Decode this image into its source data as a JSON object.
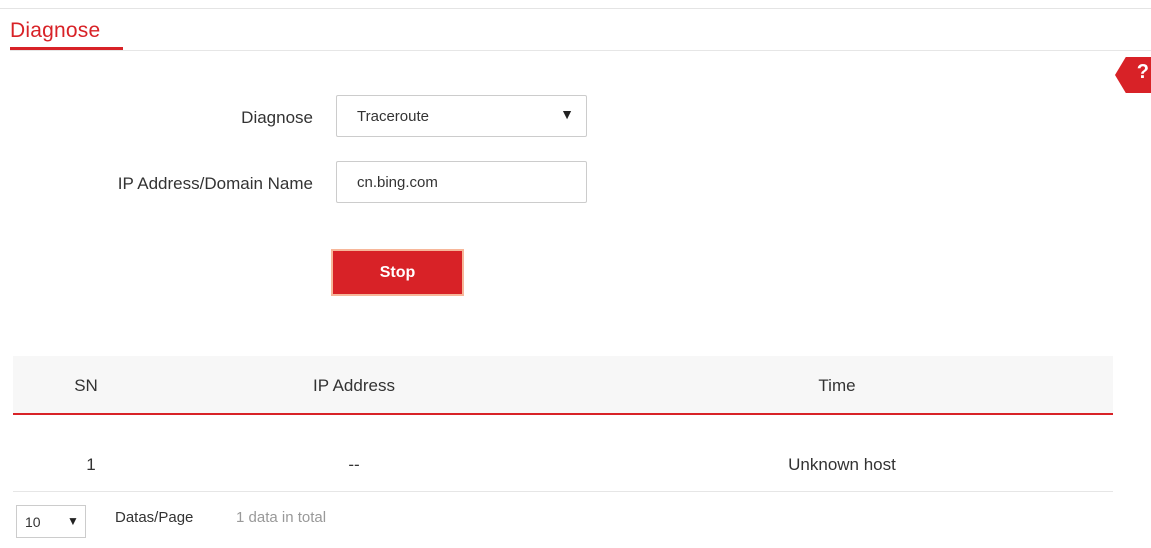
{
  "header": {
    "title": "Diagnose",
    "help_glyph": "?"
  },
  "colors": {
    "accent": "#d82227"
  },
  "form": {
    "diagnose_label": "Diagnose",
    "diagnose_value": "Traceroute",
    "address_label": "IP Address/Domain Name",
    "address_value": "cn.bing.com",
    "stop_label": "Stop"
  },
  "table": {
    "columns": [
      "SN",
      "IP Address",
      "Time"
    ],
    "rows": [
      [
        "1",
        "--",
        "Unknown host"
      ]
    ]
  },
  "pagination": {
    "per_page_value": "10",
    "per_page_label": "Datas/Page",
    "total_text": "1 data in total"
  },
  "icons": {
    "select_arrow": "▼",
    "help": "help-icon"
  }
}
